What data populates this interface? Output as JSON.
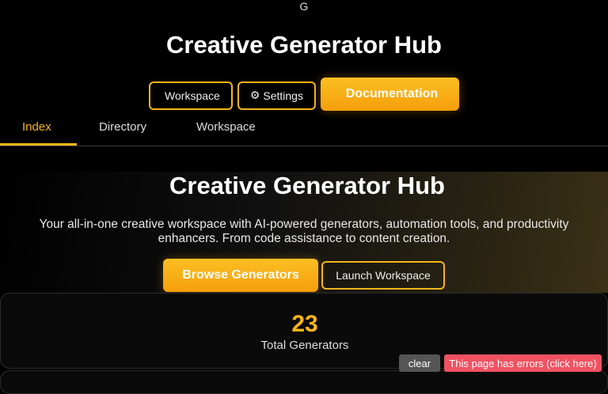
{
  "top_glyph": "G",
  "header": {
    "title": "Creative Generator Hub"
  },
  "top_actions": {
    "workspace": {
      "icon": "",
      "label": "Workspace"
    },
    "settings": {
      "icon": "⚙",
      "label": "Settings"
    },
    "documentation": {
      "icon": "",
      "label": "Documentation"
    }
  },
  "tabs": [
    {
      "icon": "",
      "label": "Index",
      "active": true
    },
    {
      "icon": "",
      "label": "Directory",
      "active": false
    },
    {
      "icon": "",
      "label": "Workspace",
      "active": false
    }
  ],
  "hero": {
    "icon": "",
    "title": "Creative Generator Hub",
    "description": "Your all-in-one creative workspace with AI-powered generators, automation tools, and productivity enhancers. From code assistance to content creation.",
    "browse_label": "Browse Generators",
    "launch_label": "Launch Workspace"
  },
  "stats": [
    {
      "value": "23",
      "label": "Total Generators"
    }
  ],
  "error_bar": {
    "clear_icon": "",
    "clear_label": "clear",
    "message": "This page has errors (click here)"
  },
  "colors": {
    "accent": "#f7b51a",
    "error": "#f05262"
  }
}
